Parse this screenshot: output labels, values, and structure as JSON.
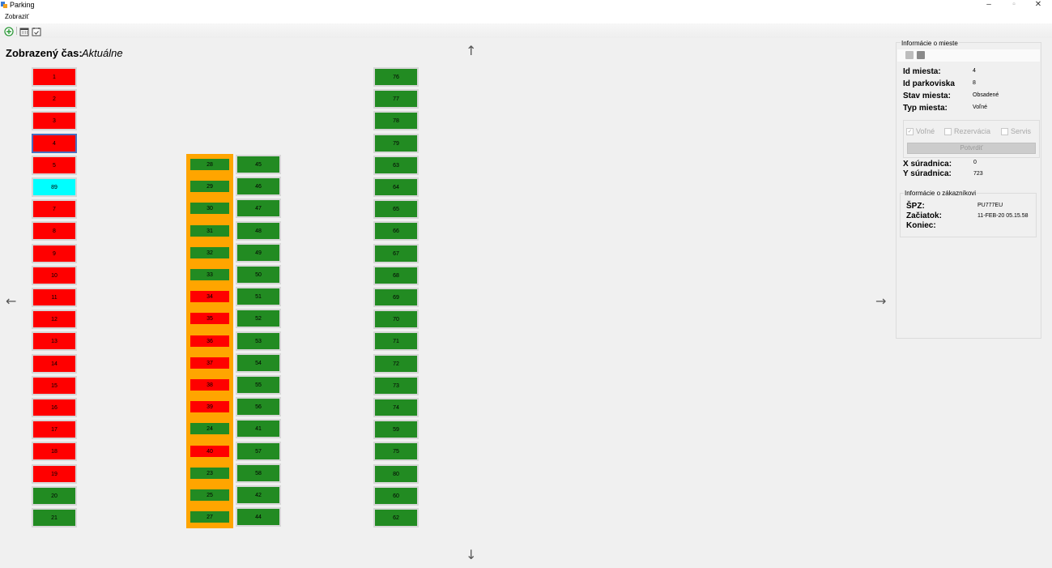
{
  "window": {
    "title": "Parking",
    "minimize": "–",
    "maximize": "▫",
    "close": "✕"
  },
  "menu": {
    "view": "Zobraziť"
  },
  "toolbar": {
    "add_icon": "plus-circle-icon",
    "calendar_icon": "calendar-icon",
    "date_icon": "calendar-check-icon"
  },
  "display_time": {
    "label": "Zobrazený čas:",
    "value": "Aktuálne"
  },
  "nav": {
    "up": "↑",
    "down": "↓",
    "left": "←",
    "right": "→"
  },
  "colors": {
    "occupied": "#ff0000",
    "free": "#228b22",
    "selected_special": "#00ffff",
    "reserved_zone": "#ffa500"
  },
  "parking": {
    "column1": [
      {
        "id": "1",
        "state": "red"
      },
      {
        "id": "2",
        "state": "red"
      },
      {
        "id": "3",
        "state": "red"
      },
      {
        "id": "4",
        "state": "red",
        "selected": true
      },
      {
        "id": "5",
        "state": "red"
      },
      {
        "id": "89",
        "state": "cyan"
      },
      {
        "id": "7",
        "state": "red"
      },
      {
        "id": "8",
        "state": "red"
      },
      {
        "id": "9",
        "state": "red"
      },
      {
        "id": "10",
        "state": "red"
      },
      {
        "id": "11",
        "state": "red"
      },
      {
        "id": "12",
        "state": "red"
      },
      {
        "id": "13",
        "state": "red"
      },
      {
        "id": "14",
        "state": "red"
      },
      {
        "id": "15",
        "state": "red"
      },
      {
        "id": "16",
        "state": "red"
      },
      {
        "id": "17",
        "state": "red"
      },
      {
        "id": "18",
        "state": "red"
      },
      {
        "id": "19",
        "state": "red"
      },
      {
        "id": "20",
        "state": "green"
      },
      {
        "id": "21",
        "state": "green"
      }
    ],
    "column2": [
      {
        "id": "28",
        "state": "green"
      },
      {
        "id": "29",
        "state": "green"
      },
      {
        "id": "30",
        "state": "green"
      },
      {
        "id": "31",
        "state": "green"
      },
      {
        "id": "32",
        "state": "green"
      },
      {
        "id": "33",
        "state": "green"
      },
      {
        "id": "34",
        "state": "red"
      },
      {
        "id": "35",
        "state": "red"
      },
      {
        "id": "36",
        "state": "red"
      },
      {
        "id": "37",
        "state": "red"
      },
      {
        "id": "38",
        "state": "red"
      },
      {
        "id": "39",
        "state": "red"
      },
      {
        "id": "24",
        "state": "green"
      },
      {
        "id": "40",
        "state": "red"
      },
      {
        "id": "23",
        "state": "green"
      },
      {
        "id": "25",
        "state": "green"
      },
      {
        "id": "27",
        "state": "green"
      }
    ],
    "column3": [
      {
        "id": "45",
        "state": "green"
      },
      {
        "id": "46",
        "state": "green"
      },
      {
        "id": "47",
        "state": "green"
      },
      {
        "id": "48",
        "state": "green"
      },
      {
        "id": "49",
        "state": "green"
      },
      {
        "id": "50",
        "state": "green"
      },
      {
        "id": "51",
        "state": "green"
      },
      {
        "id": "52",
        "state": "green"
      },
      {
        "id": "53",
        "state": "green"
      },
      {
        "id": "54",
        "state": "green"
      },
      {
        "id": "55",
        "state": "green"
      },
      {
        "id": "56",
        "state": "green"
      },
      {
        "id": "41",
        "state": "green"
      },
      {
        "id": "57",
        "state": "green"
      },
      {
        "id": "58",
        "state": "green"
      },
      {
        "id": "42",
        "state": "green"
      },
      {
        "id": "44",
        "state": "green"
      }
    ],
    "column4": [
      {
        "id": "76",
        "state": "green"
      },
      {
        "id": "77",
        "state": "green"
      },
      {
        "id": "78",
        "state": "green"
      },
      {
        "id": "79",
        "state": "green"
      },
      {
        "id": "63",
        "state": "green"
      },
      {
        "id": "64",
        "state": "green"
      },
      {
        "id": "65",
        "state": "green"
      },
      {
        "id": "66",
        "state": "green"
      },
      {
        "id": "67",
        "state": "green"
      },
      {
        "id": "68",
        "state": "green"
      },
      {
        "id": "69",
        "state": "green"
      },
      {
        "id": "70",
        "state": "green"
      },
      {
        "id": "71",
        "state": "green"
      },
      {
        "id": "72",
        "state": "green"
      },
      {
        "id": "73",
        "state": "green"
      },
      {
        "id": "74",
        "state": "green"
      },
      {
        "id": "59",
        "state": "green"
      },
      {
        "id": "75",
        "state": "green"
      },
      {
        "id": "80",
        "state": "green"
      },
      {
        "id": "60",
        "state": "green"
      },
      {
        "id": "62",
        "state": "green"
      }
    ]
  },
  "info_panel": {
    "title": "Informácie o mieste",
    "id_miesta_label": "Id miesta:",
    "id_miesta_value": "4",
    "id_parkoviska_label": "Id parkoviska",
    "id_parkoviska_value": "8",
    "stav_label": "Stav miesta:",
    "stav_value": "Obsadené",
    "typ_label": "Typ miesta:",
    "typ_value": "Voľné",
    "checkbox_free": "Voľné",
    "checkbox_reservation": "Rezervácia",
    "checkbox_service": "Servis",
    "confirm": "Potvrdiť",
    "x_label": "X súradnica:",
    "x_value": "0",
    "y_label": "Y súradnica:",
    "y_value": "723"
  },
  "customer": {
    "title": "Informácie o zákazníkovi",
    "spz_label": "ŠPZ:",
    "spz_value": "PU777EU",
    "start_label": "Začiatok:",
    "start_value": "11-FEB-20 05.15.58",
    "end_label": "Koniec:",
    "end_value": ""
  }
}
